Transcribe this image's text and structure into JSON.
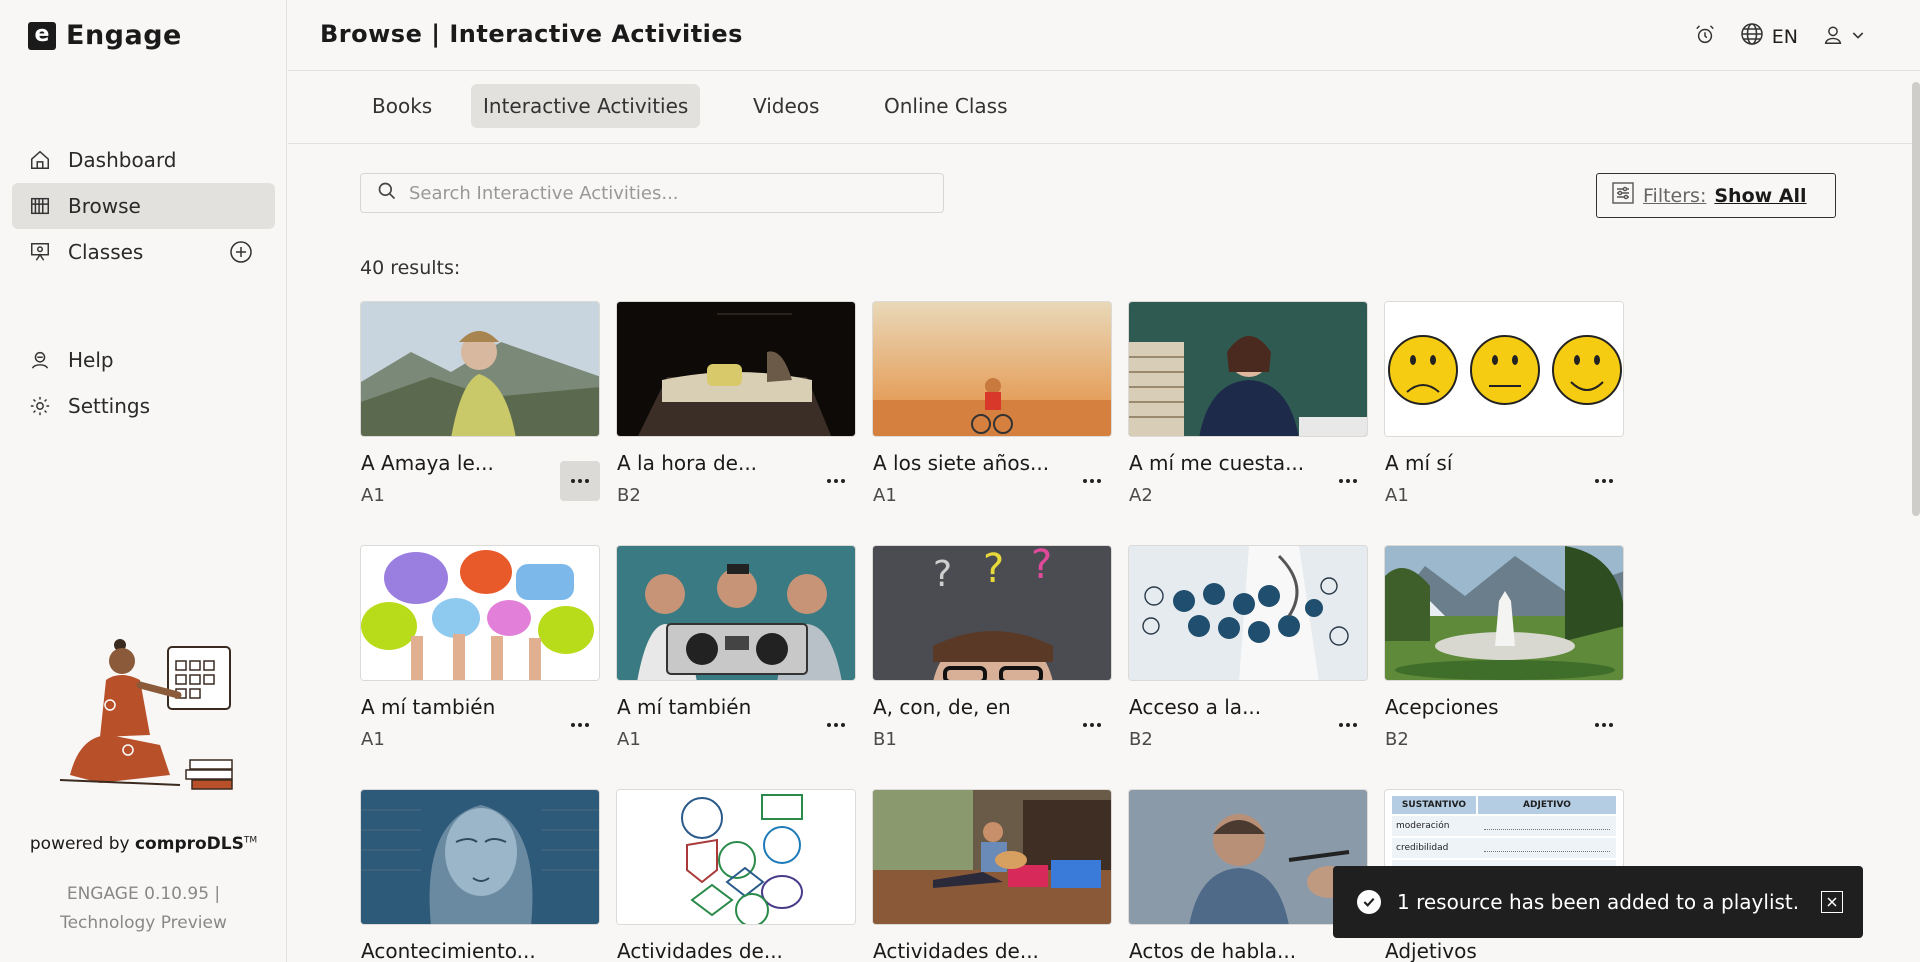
{
  "app": {
    "logo_letter": "e",
    "name": "Engage"
  },
  "sidebar": {
    "items": [
      {
        "label": "Dashboard",
        "icon": "home-icon"
      },
      {
        "label": "Browse",
        "icon": "library-icon"
      },
      {
        "label": "Classes",
        "icon": "classroom-icon"
      },
      {
        "label": "Help",
        "icon": "help-icon"
      },
      {
        "label": "Settings",
        "icon": "gear-icon"
      }
    ],
    "powered_prefix": "powered by",
    "powered_brand": "comproDLS",
    "powered_tm": "TM",
    "version_line1": "ENGAGE 0.10.95 |",
    "version_line2": "Technology Preview"
  },
  "header": {
    "title": "Browse | Interactive Activities",
    "language": "EN"
  },
  "tabs": [
    "Books",
    "Interactive Activities",
    "Videos",
    "Online Class"
  ],
  "search": {
    "placeholder": "Search Interactive Activities..."
  },
  "filters": {
    "label": "Filters:",
    "value": "Show All"
  },
  "results_text": "40 results:",
  "cards": [
    {
      "title": "A Amaya le...",
      "level": "A1"
    },
    {
      "title": "A la hora de...",
      "level": "B2"
    },
    {
      "title": "A los siete años...",
      "level": "A1"
    },
    {
      "title": "A mí me cuesta...",
      "level": "A2"
    },
    {
      "title": "A mí sí",
      "level": "A1"
    },
    {
      "title": "A mí también",
      "level": "A1"
    },
    {
      "title": "A mí también",
      "level": "A1"
    },
    {
      "title": "A, con, de, en",
      "level": "B1"
    },
    {
      "title": "Acceso a la...",
      "level": "B2"
    },
    {
      "title": "Acepciones",
      "level": "B2"
    },
    {
      "title": "Acontecimiento...",
      "level": ""
    },
    {
      "title": "Actividades de...",
      "level": ""
    },
    {
      "title": "Actividades de...",
      "level": ""
    },
    {
      "title": "Actos de habla...",
      "level": ""
    },
    {
      "title": "Adjetivos",
      "level": ""
    }
  ],
  "thumb_table": {
    "col1": "SUSTANTIVO",
    "col2": "ADJETIVO",
    "row1": "moderación",
    "row2": "credibilidad"
  },
  "toast": {
    "message": "1 resource has been added to a playlist."
  }
}
